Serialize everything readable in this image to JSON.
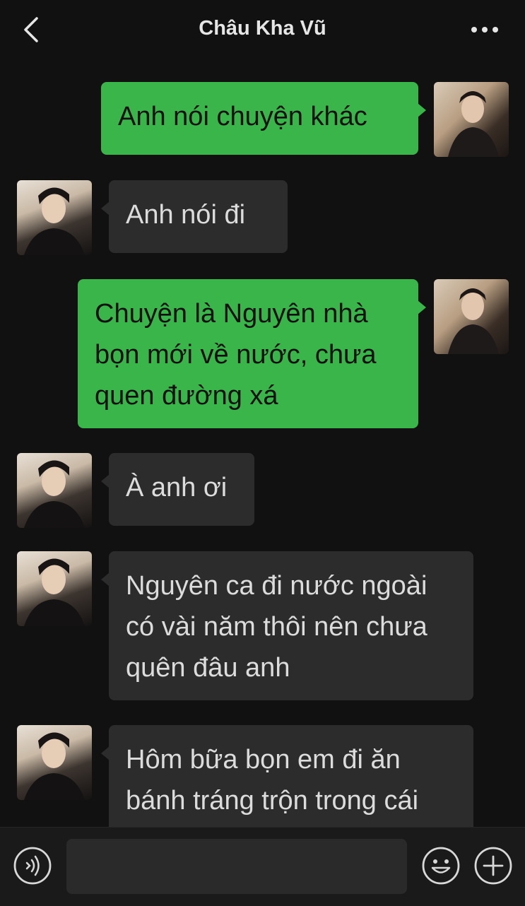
{
  "header": {
    "title": "Châu Kha Vũ",
    "back_icon": "chevron-left-icon",
    "more_icon": "more-horizontal-icon"
  },
  "colors": {
    "background": "#111111",
    "outgoing_bubble": "#39b54a",
    "incoming_bubble": "#2c2c2c"
  },
  "messages": [
    {
      "direction": "outgoing",
      "text": "Anh nói chuyện khác"
    },
    {
      "direction": "incoming",
      "text": "Anh nói đi"
    },
    {
      "direction": "outgoing",
      "text": "Chuyện là Nguyên nhà bọn mới về nước, chưa quen đường xá"
    },
    {
      "direction": "incoming",
      "text": "À anh ơi"
    },
    {
      "direction": "incoming",
      "text": "Nguyên ca đi nước ngoài có vài năm thôi nên chưa quên đâu anh"
    },
    {
      "direction": "incoming",
      "text": "Hôm bữa bọn em đi ăn bánh tráng trộn trong cái"
    }
  ],
  "input_bar": {
    "voice_icon": "voice-icon",
    "text_value": "",
    "emoji_icon": "emoji-icon",
    "plus_icon": "plus-circle-icon"
  }
}
